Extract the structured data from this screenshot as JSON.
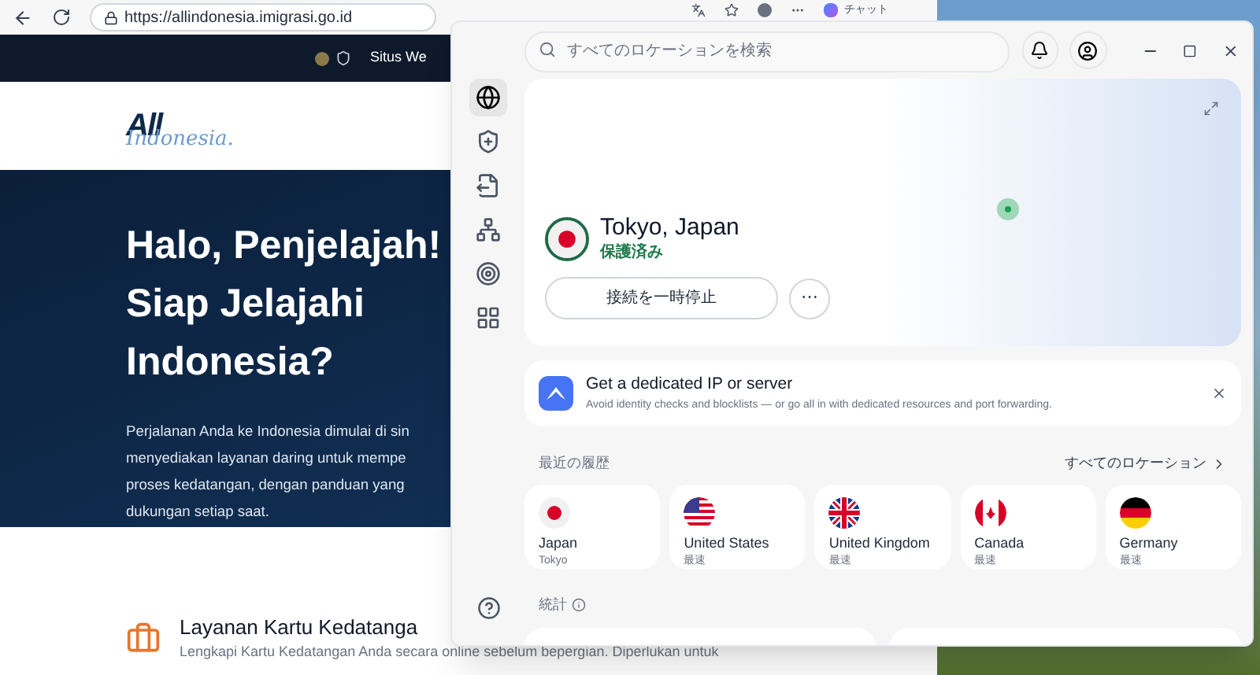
{
  "browser": {
    "url": "https://allindonesia.imigrasi.go.id",
    "copilot_label": "チャット",
    "header_text": "Situs We",
    "logo": {
      "main": "All",
      "script": "Indonesia."
    },
    "hero": {
      "title_lines": [
        "Halo, Penjelajah!",
        "Siap Jelajahi",
        "Indonesia?"
      ],
      "body_lines": [
        "Perjalanan Anda ke Indonesia dimulai di sin",
        "menyediakan layanan daring untuk mempe",
        "proses kedatangan, dengan panduan yang",
        "dukungan setiap saat."
      ]
    },
    "service": {
      "title": "Layanan Kartu Kedatanga",
      "description": "Lengkapi Kartu Kedatangan Anda secara online sebelum bepergian. Diperlukan untuk"
    }
  },
  "vpn": {
    "search": {
      "placeholder": "すべてのロケーションを検索"
    },
    "sidebar": [
      {
        "kind": "globe",
        "selected": true
      },
      {
        "kind": "shield",
        "selected": false
      },
      {
        "kind": "file",
        "selected": false
      },
      {
        "kind": "nodes",
        "selected": false
      },
      {
        "kind": "target",
        "selected": false
      },
      {
        "kind": "grid",
        "selected": false
      }
    ],
    "connection": {
      "location": "Tokyo, Japan",
      "status": "保護済み",
      "pause_button": "接続を一時停止",
      "more_button": "⋯"
    },
    "banner": {
      "title": "Get a dedicated IP or server",
      "description": "Avoid identity checks and blocklists — or go all in with dedicated resources and port forwarding."
    },
    "recent": {
      "heading": "最近の履歴",
      "all_link": "すべてのロケーション",
      "items": [
        {
          "kind": "jp",
          "country": "Japan",
          "detail": "Tokyo"
        },
        {
          "kind": "us",
          "country": "United States",
          "detail": "最速"
        },
        {
          "kind": "gb",
          "country": "United Kingdom",
          "detail": "最速"
        },
        {
          "kind": "ca",
          "country": "Canada",
          "detail": "最速"
        },
        {
          "kind": "de",
          "country": "Germany",
          "detail": "最速"
        }
      ]
    },
    "stats": {
      "heading": "統計"
    }
  }
}
